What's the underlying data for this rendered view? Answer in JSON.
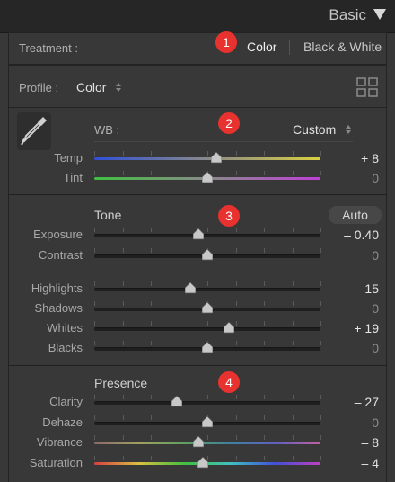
{
  "header": {
    "title": "Basic"
  },
  "badges": [
    "1",
    "2",
    "3",
    "4"
  ],
  "treatment": {
    "label": "Treatment :",
    "color": "Color",
    "bw": "Black & White"
  },
  "profile": {
    "label": "Profile :",
    "value": "Color"
  },
  "wb": {
    "label": "WB :",
    "value": "Custom"
  },
  "sections": {
    "tone": "Tone",
    "presence": "Presence",
    "auto": "Auto"
  },
  "sliders": [
    {
      "id": "temp",
      "label": "Temp",
      "value": "+ 8",
      "pos": 0.54,
      "track": "temp"
    },
    {
      "id": "tint",
      "label": "Tint",
      "value": "0",
      "pos": 0.5,
      "track": "tint"
    },
    {
      "id": "exposure",
      "label": "Exposure",
      "value": "– 0.40",
      "pos": 0.46,
      "track": "plain"
    },
    {
      "id": "contrast",
      "label": "Contrast",
      "value": "0",
      "pos": 0.5,
      "track": "plain"
    },
    {
      "id": "highlights",
      "label": "Highlights",
      "value": "– 15",
      "pos": 0.425,
      "track": "plain"
    },
    {
      "id": "shadows",
      "label": "Shadows",
      "value": "0",
      "pos": 0.5,
      "track": "plain"
    },
    {
      "id": "whites",
      "label": "Whites",
      "value": "+ 19",
      "pos": 0.595,
      "track": "plain"
    },
    {
      "id": "blacks",
      "label": "Blacks",
      "value": "0",
      "pos": 0.5,
      "track": "plain"
    },
    {
      "id": "clarity",
      "label": "Clarity",
      "value": "– 27",
      "pos": 0.365,
      "track": "plain"
    },
    {
      "id": "dehaze",
      "label": "Dehaze",
      "value": "0",
      "pos": 0.5,
      "track": "plain"
    },
    {
      "id": "vibrance",
      "label": "Vibrance",
      "value": "– 8",
      "pos": 0.46,
      "track": "vib"
    },
    {
      "id": "saturation",
      "label": "Saturation",
      "value": "– 4",
      "pos": 0.48,
      "track": "sat"
    }
  ],
  "colors": {
    "badge": "#e8322f",
    "temp": [
      "#3050d8",
      "#d8d040"
    ],
    "tint": [
      "#40c040",
      "#c040d8"
    ]
  }
}
